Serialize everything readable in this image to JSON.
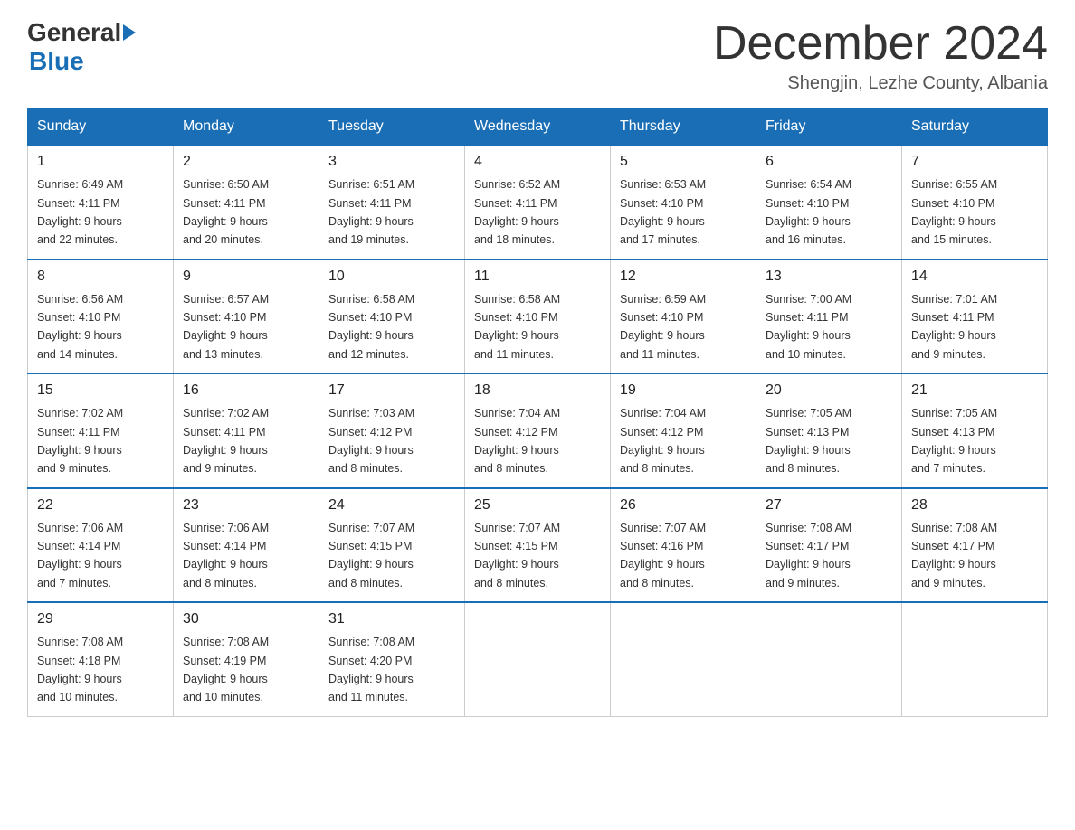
{
  "header": {
    "logo_general": "General",
    "logo_blue": "Blue",
    "month_title": "December 2024",
    "location": "Shengjin, Lezhe County, Albania"
  },
  "days_of_week": [
    "Sunday",
    "Monday",
    "Tuesday",
    "Wednesday",
    "Thursday",
    "Friday",
    "Saturday"
  ],
  "weeks": [
    [
      {
        "day": "1",
        "sunrise": "6:49 AM",
        "sunset": "4:11 PM",
        "daylight": "9 hours and 22 minutes."
      },
      {
        "day": "2",
        "sunrise": "6:50 AM",
        "sunset": "4:11 PM",
        "daylight": "9 hours and 20 minutes."
      },
      {
        "day": "3",
        "sunrise": "6:51 AM",
        "sunset": "4:11 PM",
        "daylight": "9 hours and 19 minutes."
      },
      {
        "day": "4",
        "sunrise": "6:52 AM",
        "sunset": "4:11 PM",
        "daylight": "9 hours and 18 minutes."
      },
      {
        "day": "5",
        "sunrise": "6:53 AM",
        "sunset": "4:10 PM",
        "daylight": "9 hours and 17 minutes."
      },
      {
        "day": "6",
        "sunrise": "6:54 AM",
        "sunset": "4:10 PM",
        "daylight": "9 hours and 16 minutes."
      },
      {
        "day": "7",
        "sunrise": "6:55 AM",
        "sunset": "4:10 PM",
        "daylight": "9 hours and 15 minutes."
      }
    ],
    [
      {
        "day": "8",
        "sunrise": "6:56 AM",
        "sunset": "4:10 PM",
        "daylight": "9 hours and 14 minutes."
      },
      {
        "day": "9",
        "sunrise": "6:57 AM",
        "sunset": "4:10 PM",
        "daylight": "9 hours and 13 minutes."
      },
      {
        "day": "10",
        "sunrise": "6:58 AM",
        "sunset": "4:10 PM",
        "daylight": "9 hours and 12 minutes."
      },
      {
        "day": "11",
        "sunrise": "6:58 AM",
        "sunset": "4:10 PM",
        "daylight": "9 hours and 11 minutes."
      },
      {
        "day": "12",
        "sunrise": "6:59 AM",
        "sunset": "4:10 PM",
        "daylight": "9 hours and 11 minutes."
      },
      {
        "day": "13",
        "sunrise": "7:00 AM",
        "sunset": "4:11 PM",
        "daylight": "9 hours and 10 minutes."
      },
      {
        "day": "14",
        "sunrise": "7:01 AM",
        "sunset": "4:11 PM",
        "daylight": "9 hours and 9 minutes."
      }
    ],
    [
      {
        "day": "15",
        "sunrise": "7:02 AM",
        "sunset": "4:11 PM",
        "daylight": "9 hours and 9 minutes."
      },
      {
        "day": "16",
        "sunrise": "7:02 AM",
        "sunset": "4:11 PM",
        "daylight": "9 hours and 9 minutes."
      },
      {
        "day": "17",
        "sunrise": "7:03 AM",
        "sunset": "4:12 PM",
        "daylight": "9 hours and 8 minutes."
      },
      {
        "day": "18",
        "sunrise": "7:04 AM",
        "sunset": "4:12 PM",
        "daylight": "9 hours and 8 minutes."
      },
      {
        "day": "19",
        "sunrise": "7:04 AM",
        "sunset": "4:12 PM",
        "daylight": "9 hours and 8 minutes."
      },
      {
        "day": "20",
        "sunrise": "7:05 AM",
        "sunset": "4:13 PM",
        "daylight": "9 hours and 8 minutes."
      },
      {
        "day": "21",
        "sunrise": "7:05 AM",
        "sunset": "4:13 PM",
        "daylight": "9 hours and 7 minutes."
      }
    ],
    [
      {
        "day": "22",
        "sunrise": "7:06 AM",
        "sunset": "4:14 PM",
        "daylight": "9 hours and 7 minutes."
      },
      {
        "day": "23",
        "sunrise": "7:06 AM",
        "sunset": "4:14 PM",
        "daylight": "9 hours and 8 minutes."
      },
      {
        "day": "24",
        "sunrise": "7:07 AM",
        "sunset": "4:15 PM",
        "daylight": "9 hours and 8 minutes."
      },
      {
        "day": "25",
        "sunrise": "7:07 AM",
        "sunset": "4:15 PM",
        "daylight": "9 hours and 8 minutes."
      },
      {
        "day": "26",
        "sunrise": "7:07 AM",
        "sunset": "4:16 PM",
        "daylight": "9 hours and 8 minutes."
      },
      {
        "day": "27",
        "sunrise": "7:08 AM",
        "sunset": "4:17 PM",
        "daylight": "9 hours and 9 minutes."
      },
      {
        "day": "28",
        "sunrise": "7:08 AM",
        "sunset": "4:17 PM",
        "daylight": "9 hours and 9 minutes."
      }
    ],
    [
      {
        "day": "29",
        "sunrise": "7:08 AM",
        "sunset": "4:18 PM",
        "daylight": "9 hours and 10 minutes."
      },
      {
        "day": "30",
        "sunrise": "7:08 AM",
        "sunset": "4:19 PM",
        "daylight": "9 hours and 10 minutes."
      },
      {
        "day": "31",
        "sunrise": "7:08 AM",
        "sunset": "4:20 PM",
        "daylight": "9 hours and 11 minutes."
      },
      null,
      null,
      null,
      null
    ]
  ],
  "labels": {
    "sunrise": "Sunrise:",
    "sunset": "Sunset:",
    "daylight": "Daylight:"
  }
}
